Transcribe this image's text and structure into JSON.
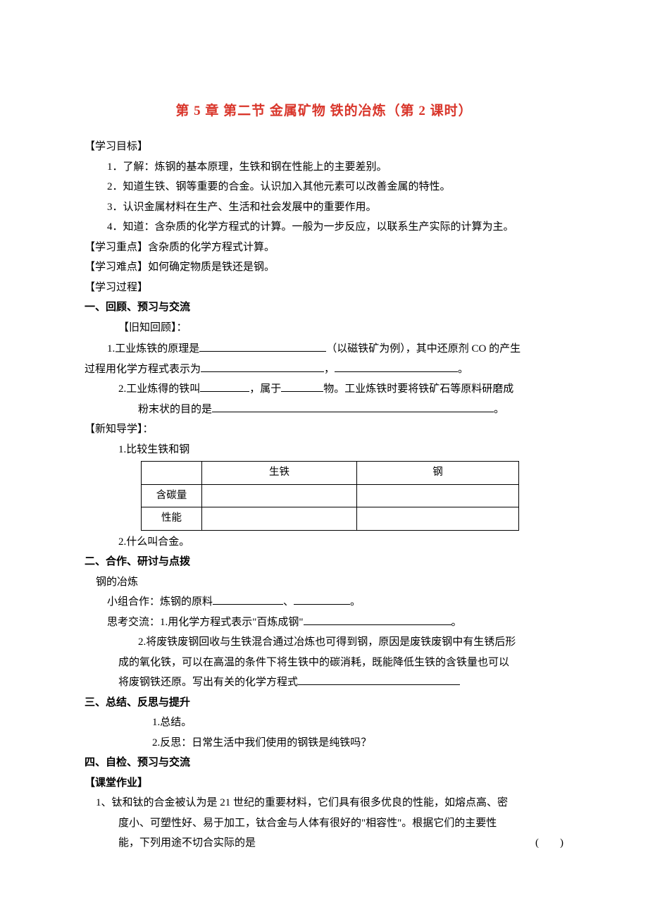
{
  "title": "第 5 章 第二节 金属矿物 铁的冶炼（第 2 课时）",
  "h_goal": "【学习目标】",
  "goals": [
    "1．了解：炼钢的基本原理，生铁和钢在性能上的主要差别。",
    "2．知道生铁、钢等重要的合金。认识加入其他元素可以改善金属的特性。",
    "3．认识金属材料在生产、生活和社会发展中的重要作用。",
    "4．知道：含杂质的化学方程式的计算。一般为一步反应，以联系生产实际的计算为主。"
  ],
  "h_focus": "【学习重点】含杂质的化学方程式计算。",
  "h_diff": "【学习难点】如何确定物质是铁还是钢。",
  "h_proc": "【学习过程】",
  "sec1": "一、回顾、预习与交流",
  "old_review": "【旧知回顾】：",
  "rev1_a": "1.工业炼铁的原理是",
  "rev1_b": "（以磁铁矿为例），其中还原剂 CO 的产生",
  "rev1_c": "过程用化学方程式表示为",
  "rev1_punc1": "，",
  "rev1_end": "。",
  "rev2_a": "2.工业炼得的铁叫",
  "rev2_b": "，属于",
  "rev2_c": "物。工业炼铁时要将铁矿石等原料研磨成",
  "rev2_d": "粉末状的目的是",
  "new_guide": "【新知导学】：",
  "ng1": "1.比较生铁和钢",
  "ng2": "2.什么叫合金。",
  "table": {
    "h1": "生铁",
    "h2": "钢",
    "r1": "含碳量",
    "r2": "性能"
  },
  "sec2": "二、合作、研讨与点拨",
  "steel_head": "钢的冶炼",
  "coop_a": "小组合作：炼钢的原料",
  "coop_sep": "、",
  "coop_end": "。",
  "think1_a": "思考交流：1.用化学方程式表示\"百炼成钢\"",
  "think1_end": "。",
  "think2_a": "2.将废铁废钢回收与生铁混合通过冶炼也可得到钢，原因是废铁废钢中有生锈后形",
  "think2_b": "成的氧化铁，可以在高温的条件下将生铁中的碳消耗，既能降低生铁的含铁量也可以",
  "think2_c": "将废钢铁还原。写出有关的化学方程式",
  "sec3": "三、总结、反思与提升",
  "s3_1": "1.总结。",
  "s3_2": "2.反思：日常生活中我们使用的钢铁是纯铁吗？",
  "sec4": "四、自检、预习与交流",
  "cw": "【课堂作业】",
  "q1_a": "1、钛和钛的合金被认为是 21 世纪的重要材料，它们具有很多优良的性能，如熔点高、密",
  "q1_b": "度小、可塑性好、易于加工，钛合金与人体有很好的\"相容性\"。根据它们的主要性",
  "q1_c": "能，下列用途不切合实际的是",
  "q1_paren": "(　　)"
}
